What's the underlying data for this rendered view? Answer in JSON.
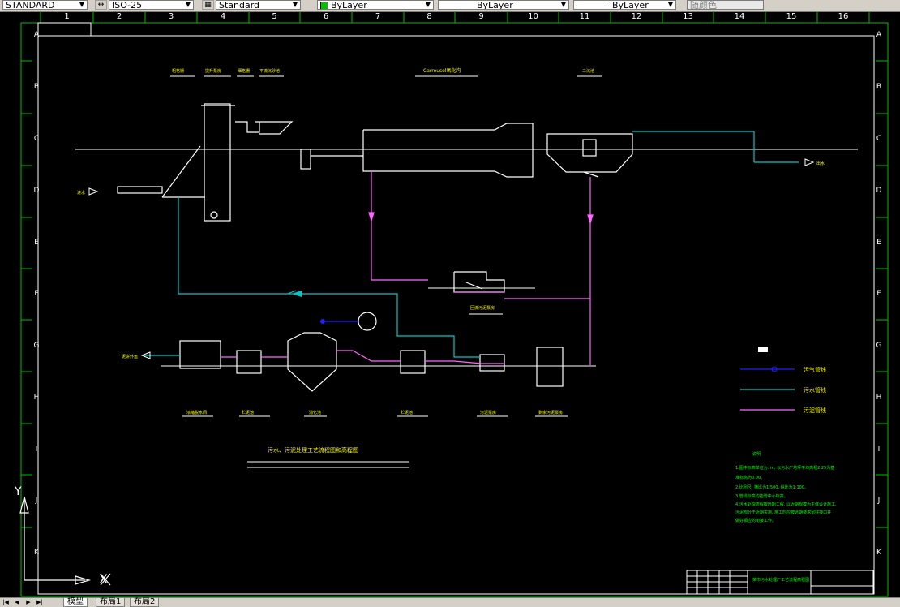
{
  "toolbar": {
    "text_style": "STANDARD",
    "dim_style": "ISO-25",
    "table_style": "Standard",
    "layer": "ByLayer",
    "linetype": "ByLayer",
    "lineweight": "ByLayer",
    "plot_style": "随颜色",
    "colors": {
      "layer_swatch": "#00c000"
    }
  },
  "grid": {
    "columns": [
      "1",
      "2",
      "3",
      "4",
      "5",
      "6",
      "7",
      "8",
      "9",
      "10",
      "11",
      "12",
      "13",
      "14",
      "15",
      "16"
    ],
    "rows": [
      "A",
      "B",
      "C",
      "D",
      "E",
      "F",
      "G",
      "H",
      "I",
      "J",
      "K"
    ]
  },
  "drawing": {
    "top_labels": [
      "粗格栅",
      "提升泵房",
      "细格栅",
      "平流沉砂池",
      "Carrousel氧化沟",
      "二沉池"
    ],
    "inlet_label": "进水",
    "outlet_label": "出水",
    "bottom_labels": [
      "浓缩脱水间",
      "贮泥池",
      "消化池",
      "贮泥池",
      "污泥泵房",
      "剩余污泥泵房"
    ],
    "sludge_pump_label": "回流污泥泵房",
    "sludge_out_label": "泥饼外运",
    "main_title": "污水、污泥处理工艺流程图和高程图",
    "legend_title": "图例",
    "legend": [
      {
        "label": "污气管线",
        "color": "#2020ff"
      },
      {
        "label": "污水管线",
        "color": "#00c8c8"
      },
      {
        "label": "污泥管线",
        "color": "#ff66ff"
      }
    ],
    "notes_title": "说明",
    "notes": [
      "1.图中标高单位为: m, 以污水厂地坪平均高程2.25为基",
      "  准标高为0.00。",
      "2.比例尺: 横比为1:500, 纵比为1:100。",
      "3.管线标高均指管中心标高。",
      "4.污水处理流程按远期工程, 以近期规模为主体设计施工,",
      "  污泥部分于近期实施, 施工时应按远期要求留好接口并",
      "  做好相应的衔接工作。"
    ],
    "title_block": "某市污水处理厂工艺流程高程图",
    "colors": {
      "frame": "#ffffff",
      "border": "#00c000",
      "water": "#00c8c8",
      "sludge": "#ff66ff",
      "gas": "#2020ff",
      "text": "#00ff00",
      "label": "#ffff00"
    }
  },
  "ucs": {
    "y": "Y",
    "x": "X"
  },
  "tabs": [
    "模型",
    "布局1",
    "布局2"
  ]
}
